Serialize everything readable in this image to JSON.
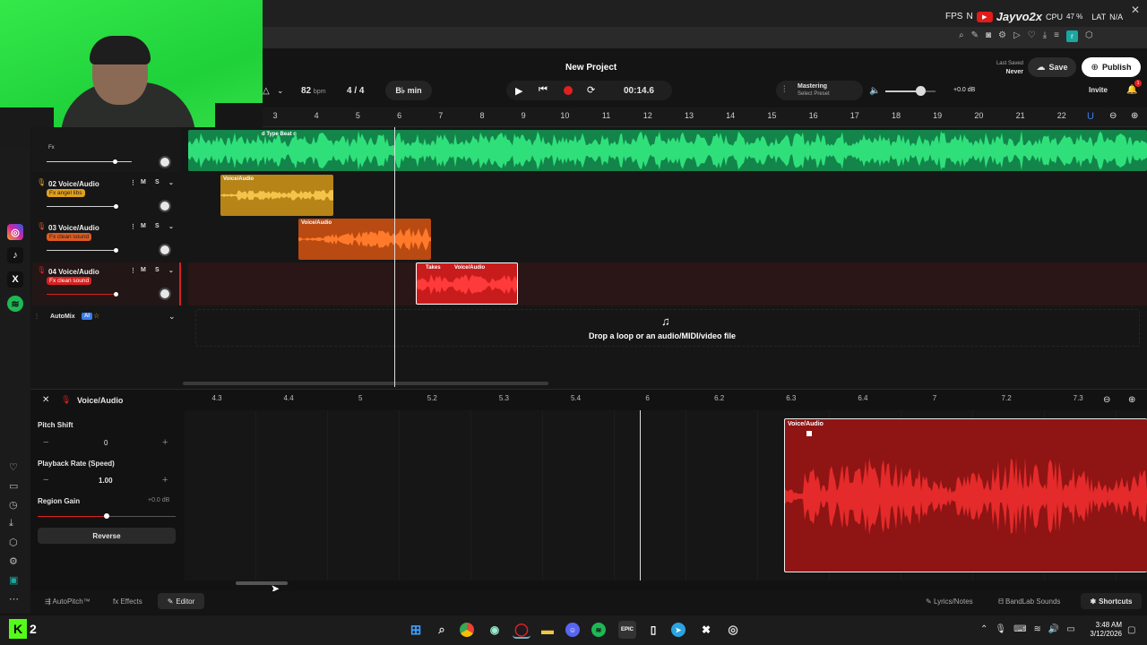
{
  "overlay": {
    "fps": "FPS",
    "n_label": "N",
    "channel": "Jayvo2x",
    "cpu": "CPU",
    "cpu_val": "47 %",
    "lat": "LAT",
    "lat_val": "N/A"
  },
  "header": {
    "project_title": "New Project",
    "last_saved_label": "Last Saved",
    "last_saved_value": "Never",
    "save_label": "Save",
    "publish_label": "Publish",
    "invite_label": "Invite",
    "notif_count": "1"
  },
  "transport": {
    "bpm": "82",
    "bpm_unit": "bpm",
    "time_sig": "4 / 4",
    "key": "B♭ min",
    "time": "00:14.6",
    "mastering_label": "Mastering",
    "mastering_sub": "Select Preset",
    "volume_db": "+0.0 dB",
    "volume_level": 0.7
  },
  "ruler": [
    "3",
    "4",
    "5",
    "6",
    "7",
    "8",
    "9",
    "10",
    "11",
    "12",
    "13",
    "14",
    "15",
    "16",
    "17",
    "18",
    "19",
    "20",
    "21",
    "22"
  ],
  "tracks": {
    "beat_label": "d Type Beat o",
    "beat_fx": "Fx",
    "t2": {
      "name": "02  Voice/Audio",
      "fx": "Fx  angel libs",
      "clip": "Voice/Audio"
    },
    "t3": {
      "name": "03  Voice/Audio",
      "fx": "Fx  clean sound",
      "clip": "Voice/Audio"
    },
    "t4": {
      "name": "04  Voice/Audio",
      "fx": "Fx  clean sound",
      "clip": "Voice/Audio",
      "takes": "Takes"
    },
    "m": "M",
    "s": "S",
    "automix": "AutoMix",
    "ai": "AI"
  },
  "drop": {
    "text": "Drop a loop or an audio/MIDI/video file"
  },
  "editor": {
    "title": "Voice/Audio",
    "pitch_label": "Pitch Shift",
    "pitch_value": "0",
    "rate_label": "Playback Rate (Speed)",
    "rate_value": "1.00",
    "gain_label": "Region Gain",
    "gain_value": "+0.0 dB",
    "reverse_label": "Reverse",
    "ruler": [
      "4.3",
      "4.4",
      "5",
      "5.2",
      "5.3",
      "5.4",
      "6",
      "6.2",
      "6.3",
      "6.4",
      "7",
      "7.2",
      "7.3"
    ],
    "clip_label": "Voice/Audio"
  },
  "bottom": {
    "autopitch": "AutoPitch™",
    "effects": "Effects",
    "editor": "Editor",
    "lyrics": "Lyrics/Notes",
    "bandlab_sounds": "BandLab Sounds",
    "shortcuts": "Shortcuts"
  },
  "taskbar": {
    "time": "3:48 AM",
    "date": "3/12/2026",
    "kick_label": "2"
  },
  "colors": {
    "green": "#1fc26b",
    "yellow": "#d9a020",
    "orange": "#e0601a",
    "red": "#d8201f",
    "accent": "#1aa7a0"
  }
}
